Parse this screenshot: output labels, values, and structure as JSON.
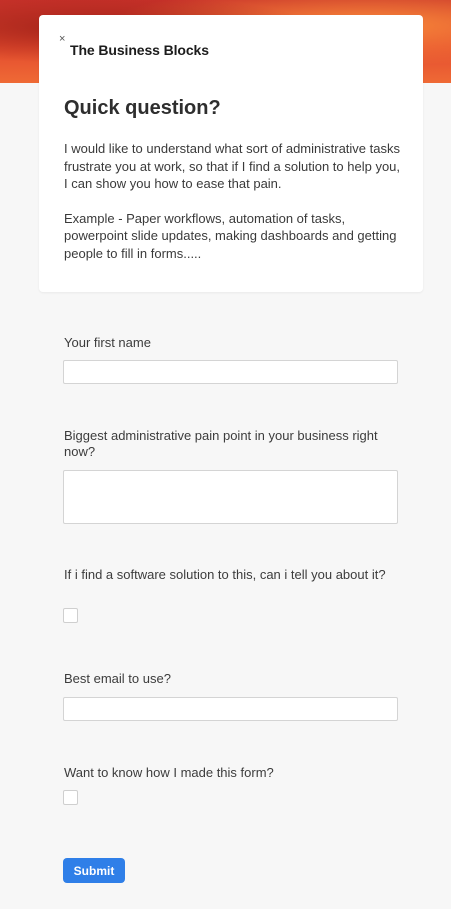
{
  "header": {
    "close_symbol": "×",
    "brand": "The Business Blocks"
  },
  "intro": {
    "title": "Quick question?",
    "paragraph_1": "I would like to understand what sort of administrative tasks frustrate you at work, so that if I find a solution to help you, I can show you how to ease that pain.",
    "paragraph_2": "Example - Paper workflows, automation of tasks, powerpoint slide updates, making dashboards and getting people to fill in forms....."
  },
  "form": {
    "first_name_label": "Your first name",
    "pain_point_label": "Biggest administrative pain point in your business right now?",
    "software_consent_label": "If i find a software solution to this, can i tell you about it?",
    "email_label": "Best email to use?",
    "how_made_label": "Want to know how I made this form?",
    "submit_label": "Submit"
  },
  "colors": {
    "banner": "#e34a2e",
    "background": "#f7f7f7",
    "submit_button": "#2f7fe8"
  },
  "icons": {
    "close": "close-icon"
  }
}
